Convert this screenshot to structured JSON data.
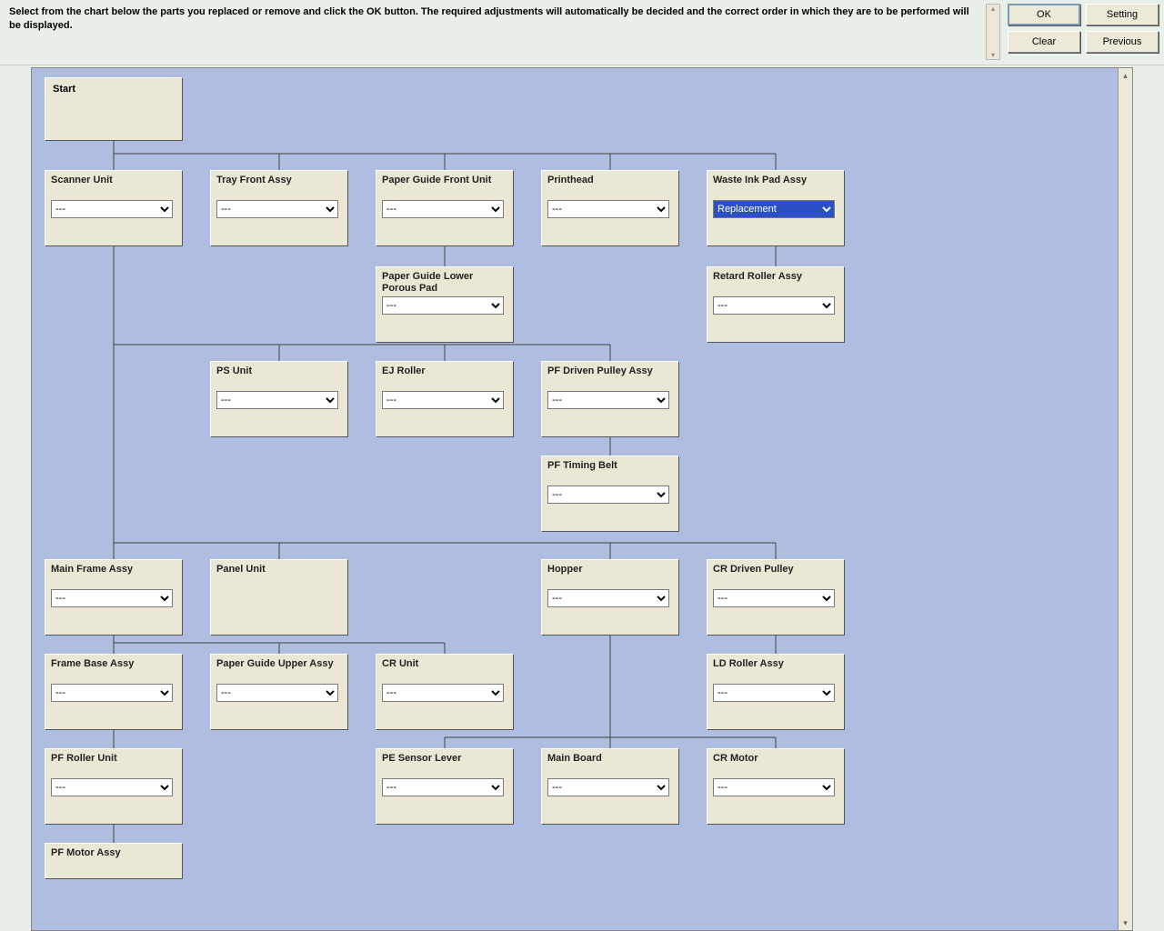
{
  "instruction": "Select from the chart below the parts you replaced or remove and click the OK button. The required adjustments will automatically be decided and the correct order in which they are to be performed will be displayed.",
  "buttons": {
    "ok": "OK",
    "setting": "Setting",
    "clear": "Clear",
    "previous": "Previous"
  },
  "dropdown_default": "---",
  "dropdown_selected": "Replacement",
  "nodes": {
    "start": "Start",
    "scanner_unit": "Scanner Unit",
    "tray_front_assy": "Tray Front Assy",
    "paper_guide_front_unit": "Paper Guide Front Unit",
    "printhead": "Printhead",
    "waste_ink_pad_assy": "Waste Ink Pad Assy",
    "paper_guide_lower_porous_pad": "Paper Guide Lower Porous Pad",
    "retard_roller_assy": "Retard Roller Assy",
    "ps_unit": "PS Unit",
    "ej_roller": "EJ Roller",
    "pf_driven_pulley_assy": "PF Driven Pulley Assy",
    "pf_timing_belt": "PF Timing Belt",
    "main_frame_assy": "Main Frame Assy",
    "panel_unit": "Panel Unit",
    "hopper": "Hopper",
    "cr_driven_pulley": "CR Driven Pulley",
    "frame_base_assy": "Frame Base Assy",
    "paper_guide_upper_assy": "Paper Guide Upper Assy",
    "cr_unit": "CR Unit",
    "ld_roller_assy": "LD Roller Assy",
    "pf_roller_unit": "PF Roller Unit",
    "pe_sensor_lever": "PE Sensor Lever",
    "main_board": "Main Board",
    "cr_motor": "CR Motor",
    "pf_motor_assy": "PF Motor Assy"
  }
}
